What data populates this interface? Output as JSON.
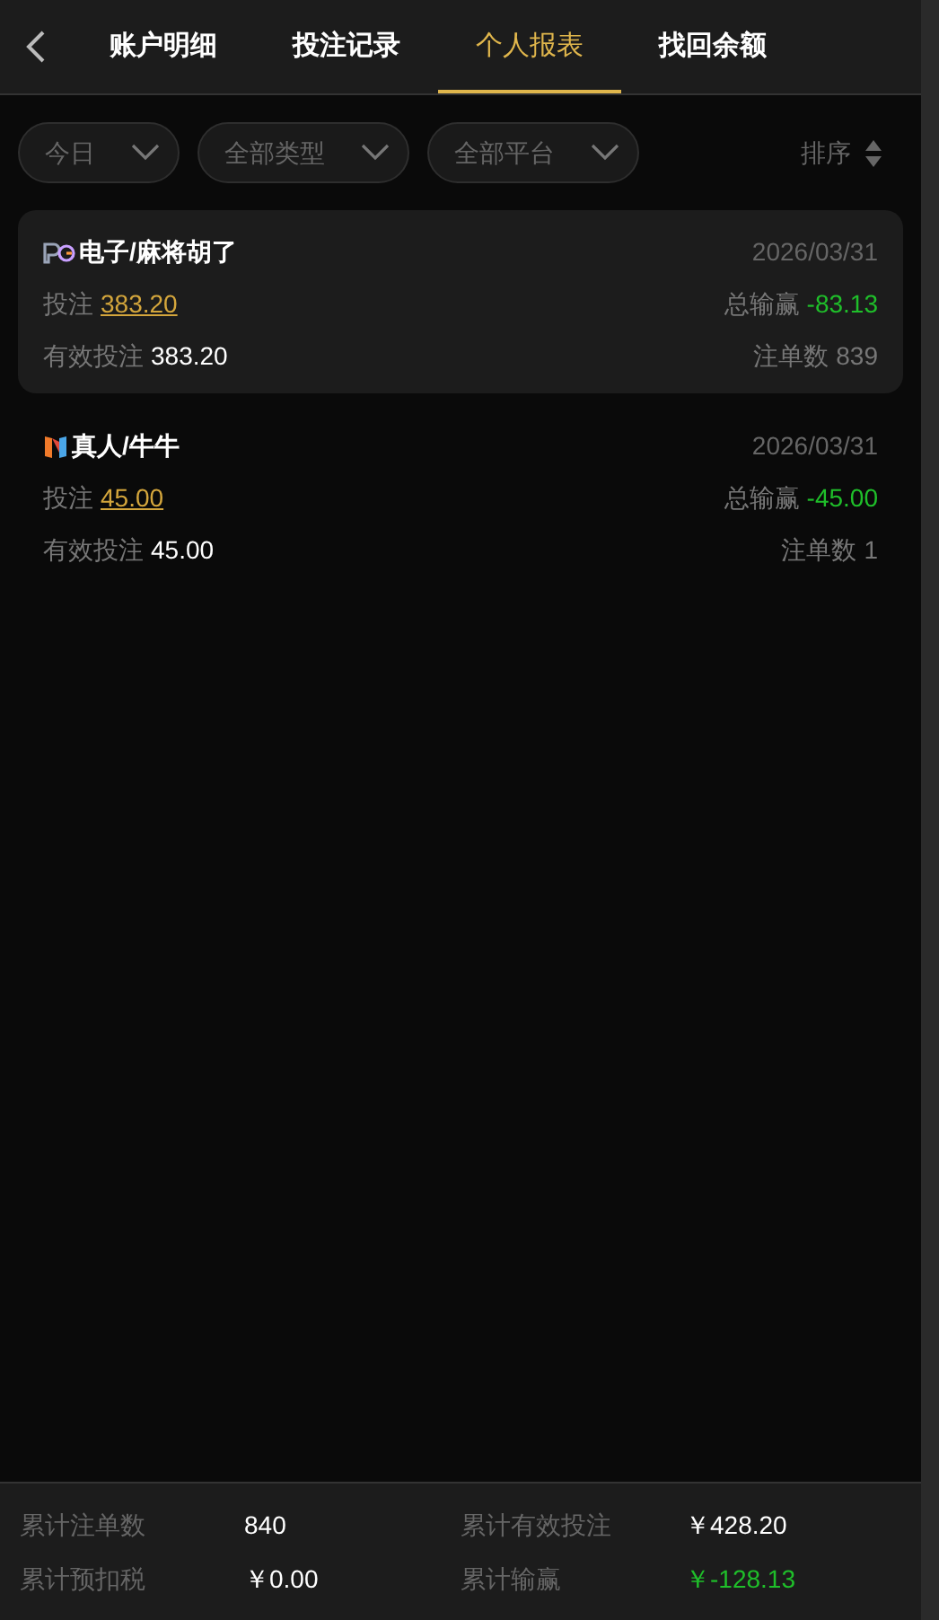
{
  "tabs": [
    {
      "label": "账户明细",
      "selected": false
    },
    {
      "label": "投注记录",
      "selected": false
    },
    {
      "label": "个人报表",
      "selected": true
    },
    {
      "label": "找回余额",
      "selected": false
    }
  ],
  "filters": [
    "今日",
    "全部类型",
    "全部平台"
  ],
  "sort": {
    "label": "排序"
  },
  "records": [
    {
      "kind": "pg",
      "title": "电子/麻将胡了",
      "date": "2026/03/31",
      "bet_label": "投注",
      "bet": "383.20",
      "winloss_label": "总输赢",
      "winloss": "-83.13",
      "valid_label": "有效投注",
      "valid": "383.20",
      "count_label": "注单数",
      "count": "839",
      "selected": true
    },
    {
      "kind": "n",
      "title": "真人/牛牛",
      "date": "2026/03/31",
      "bet_label": "投注",
      "bet": "45.00",
      "winloss_label": "总输赢",
      "winloss": "-45.00",
      "valid_label": "有效投注",
      "valid": "45.00",
      "count_label": "注单数",
      "count": "1",
      "selected": false
    }
  ],
  "summary": [
    {
      "label": "累计注单数",
      "value": "840",
      "negative": false
    },
    {
      "label": "累计有效投注",
      "value": "￥428.20",
      "negative": false
    },
    {
      "label": "累计预扣税",
      "value": "￥0.00",
      "negative": false
    },
    {
      "label": "累计输赢",
      "value": "￥-128.13",
      "negative": true
    }
  ]
}
